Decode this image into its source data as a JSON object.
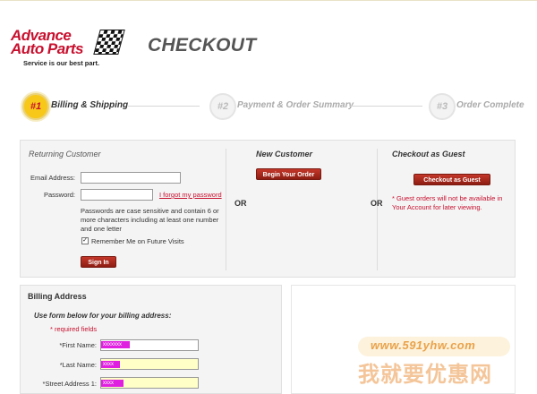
{
  "brand": {
    "logo_line1": "Advance",
    "logo_line2": "Auto Parts",
    "tagline": "Service is our best part.",
    "accent": "#c8102e"
  },
  "page_title": "CHECKOUT",
  "steps": [
    {
      "number": "#1",
      "label": "Billing & Shipping",
      "active": true
    },
    {
      "number": "#2",
      "label": "Payment & Order Summary",
      "active": false
    },
    {
      "number": "#3",
      "label": "Order Complete",
      "active": false
    }
  ],
  "returning": {
    "title": "Returning Customer",
    "email_label": "Email Address:",
    "email_value": "",
    "password_label": "Password:",
    "password_value": "",
    "forgot_link": "I forgot my password",
    "password_note": "Passwords are case sensitive and contain 6 or more characters including at least one number and one letter",
    "remember_label": "Remember Me on Future Visits",
    "remember_checked": true,
    "signin_button": "Sign In"
  },
  "or_text": "OR",
  "new_customer": {
    "title": "New Customer",
    "button": "Begin Your Order"
  },
  "guest": {
    "title": "Checkout as Guest",
    "button": "Checkout as Guest",
    "note": "* Guest orders will not be available in Your Account for later viewing."
  },
  "billing": {
    "title": "Billing Address",
    "instruction": "Use form below for your billing address:",
    "required_note": "* required fields",
    "fields": [
      {
        "label": "*First Name:",
        "redacted": "xxxxxxx"
      },
      {
        "label": "*Last Name:",
        "redacted": "xxxx"
      },
      {
        "label": "*Street Address 1:",
        "redacted": "xxxx"
      }
    ]
  },
  "watermark": {
    "url": "www.591yhw.com",
    "text": "我就要优惠网"
  },
  "icons": {
    "checkered_flag": "checkered-flag-icon",
    "check": "✓"
  }
}
